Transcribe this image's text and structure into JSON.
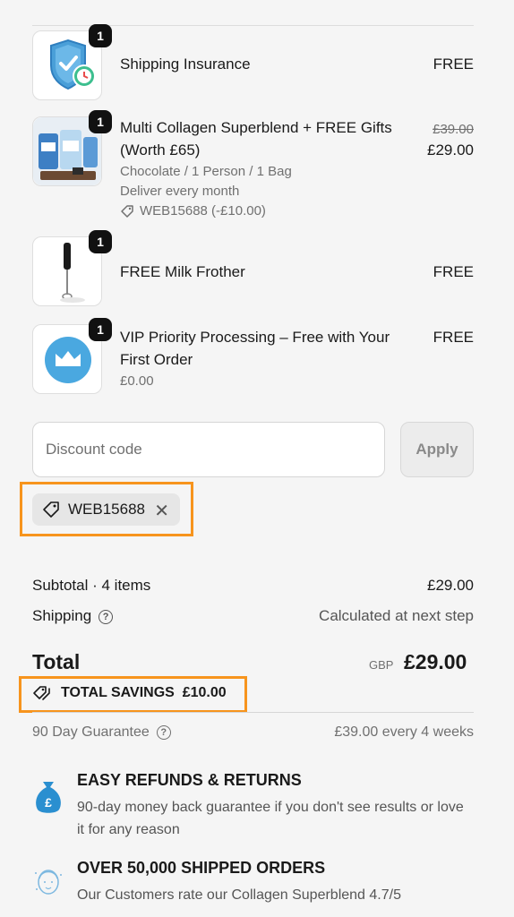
{
  "items": [
    {
      "title": "Shipping Insurance",
      "price": "FREE",
      "qty": "1"
    },
    {
      "title": "Multi Collagen Superblend + FREE Gifts (Worth £65)",
      "old_price": "£39.00",
      "price": "£29.00",
      "qty": "1",
      "variant": "Chocolate / 1 Person / 1 Bag",
      "delivery": "Deliver every month",
      "discount": "WEB15688 (-£10.00)"
    },
    {
      "title": "FREE Milk Frother",
      "price": "FREE",
      "qty": "1"
    },
    {
      "title": "VIP Priority Processing – Free with Your First Order",
      "price": "FREE",
      "qty": "1",
      "sub_price": "£0.00"
    }
  ],
  "discount": {
    "placeholder": "Discount code",
    "apply_label": "Apply",
    "applied_code": "WEB15688"
  },
  "summary": {
    "subtotal_label": "Subtotal · 4 items",
    "subtotal_value": "£29.00",
    "shipping_label": "Shipping",
    "shipping_value": "Calculated at next step",
    "total_label": "Total",
    "currency": "GBP",
    "total_value": "£29.00",
    "savings_label": "TOTAL SAVINGS  £10.00",
    "guarantee_label": "90 Day Guarantee",
    "guarantee_value": "£39.00 every 4 weeks"
  },
  "features": [
    {
      "title": "EASY REFUNDS & RETURNS",
      "body": "90-day money back guarantee if you don't see results or love it for any reason",
      "icon": "money-bag-icon"
    },
    {
      "title": "OVER 50,000 SHIPPED ORDERS",
      "body": "Our Customers rate our Collagen Superblend 4.7/5",
      "icon": "face-icon"
    }
  ],
  "colors": {
    "highlight": "#f7941d",
    "shield": "#4a9fd8",
    "crown_bg": "#4aa8e0"
  }
}
